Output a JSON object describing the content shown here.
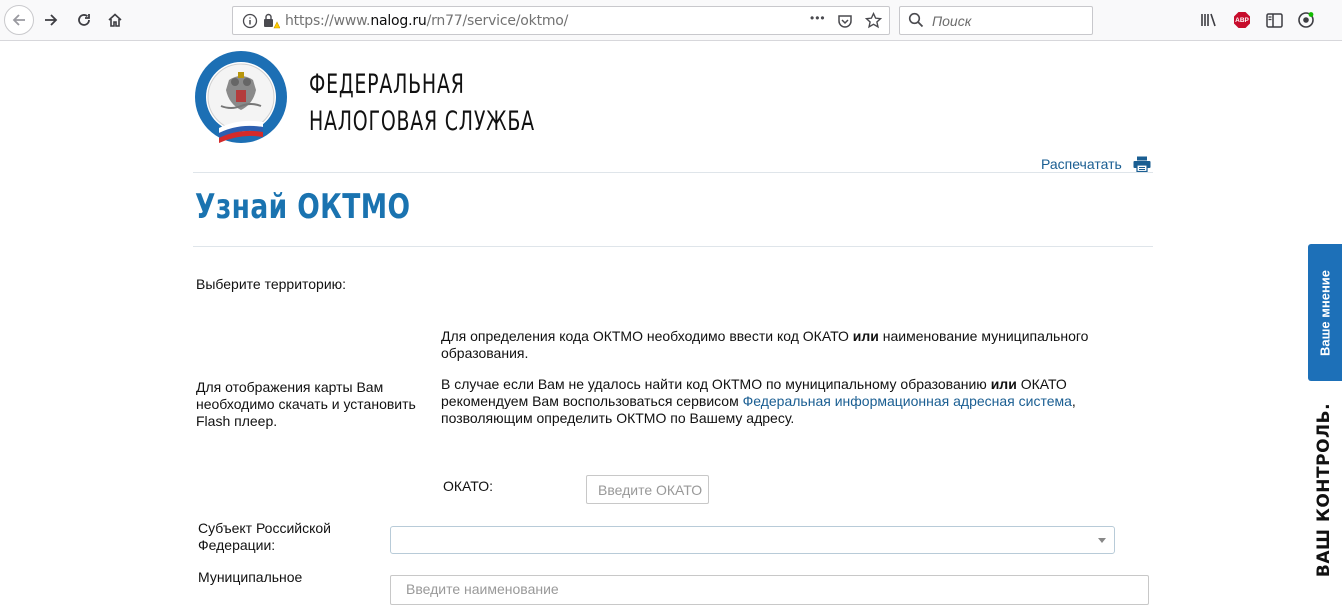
{
  "browser": {
    "url_prefix": "https://www.",
    "url_host": "nalog.ru",
    "url_path": "/rn77/service/oktmo/",
    "more_glyph": "•••",
    "search_placeholder": "Поиск",
    "abp_label": "ABP",
    "icons": [
      "back-icon",
      "forward-icon",
      "reload-icon",
      "home-icon",
      "info-icon",
      "lock-warning-icon",
      "more-icon",
      "pocket-icon",
      "bookmark-star-icon",
      "search-icon",
      "library-icon",
      "adblock-icon",
      "sidebar-icon",
      "profile-icon"
    ]
  },
  "header": {
    "org_line1": "ФЕДЕРАЛЬНАЯ",
    "org_line2": "НАЛОГОВАЯ СЛУЖБА",
    "print_label": "Распечатать"
  },
  "page": {
    "title": "Узнай ОКТМО",
    "choose_territory": "Выберите территорию:",
    "flash_note": "Для отображения карты Вам необходимо скачать и установить Flash плеер.",
    "info1_a": "Для определения кода ОКТМО необходимо ввести код ОКАТО ",
    "info1_bold": "или",
    "info1_b": " наименование муниципального образования.",
    "info2_a": "В случае если Вам не удалось найти код ОКТМО по муниципальному образованию ",
    "info2_bold": "или",
    "info2_b": " ОКАТО рекомендуем Вам воспользоваться сервисом ",
    "info2_link": "Федеральная информационная адресная система",
    "info2_c": ", позволяющим определить ОКТМО по Вашему адресу."
  },
  "form": {
    "okato_label": "ОКАТО:",
    "okato_placeholder": "Введите ОКАТО",
    "subject_label": "Субъект Российской Федерации:",
    "subject_value": "",
    "muni_label": "Муниципальное",
    "muni_placeholder": "Введите наименование"
  },
  "side": {
    "feedback_label": "Ваше мнение",
    "vk_label": "ВАШ КОНТРОЛЬ."
  },
  "colors": {
    "brand_blue": "#1a73b0",
    "link_blue": "#1a5e92",
    "feedback_bg": "#1d70b8"
  }
}
